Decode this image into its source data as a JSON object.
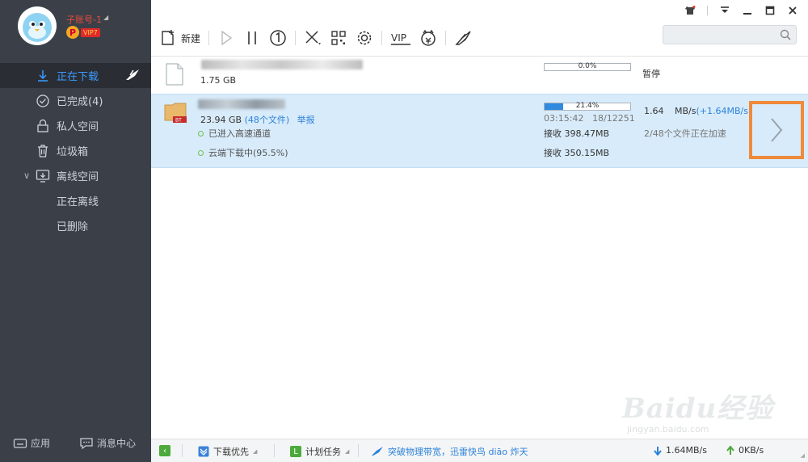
{
  "account": {
    "name": "子账号-1",
    "vip_level": "VIP7",
    "vip_badge": "P"
  },
  "nav": {
    "downloading": "正在下载",
    "completed": "已完成(4)",
    "private_space": "私人空间",
    "trash": "垃圾箱",
    "offline_space": "离线空间",
    "offline_active": "正在离线",
    "offline_deleted": "已删除"
  },
  "sidebar_bottom": {
    "apps": "应用",
    "messages": "消息中心"
  },
  "toolbar": {
    "new_label": "新建",
    "vip_label": "VIP"
  },
  "search": {
    "placeholder": ""
  },
  "tasks": [
    {
      "size": "1.75 GB",
      "progress_text": "0.0%",
      "progress": 0.0,
      "status": "暂停"
    },
    {
      "size": "23.94 GB",
      "files": "(48个文件)",
      "report": "举报",
      "badge": "BT",
      "progress_text": "21.4%",
      "progress": 0.214,
      "time": "03:15:42",
      "pieces": "18/12251",
      "speed": "1.64",
      "speed_unit": "MB/s",
      "speed_extra": "(+1.64MB/s)",
      "accel": "2/48个文件正在加速",
      "line1": "已进入高速通道",
      "line2": "云端下载中(95.5%)",
      "recv1": "接收 398.47MB",
      "recv2": "接收 350.15MB"
    }
  ],
  "statusbar": {
    "priority": "下载优先",
    "schedule": "计划任务",
    "promo": "突破物理带宽，迅雷快鸟 diāo 炸天",
    "down_speed": "1.64MB/s",
    "up_speed": "0KB/s"
  },
  "watermark": {
    "main": "Baidu经验",
    "sub": "jingyan.baidu.com"
  },
  "colors": {
    "sidebar": "#3b4048",
    "accent": "#2f8ae0",
    "selected_row": "#d8ebfa",
    "highlight_box": "#f08a3b"
  }
}
